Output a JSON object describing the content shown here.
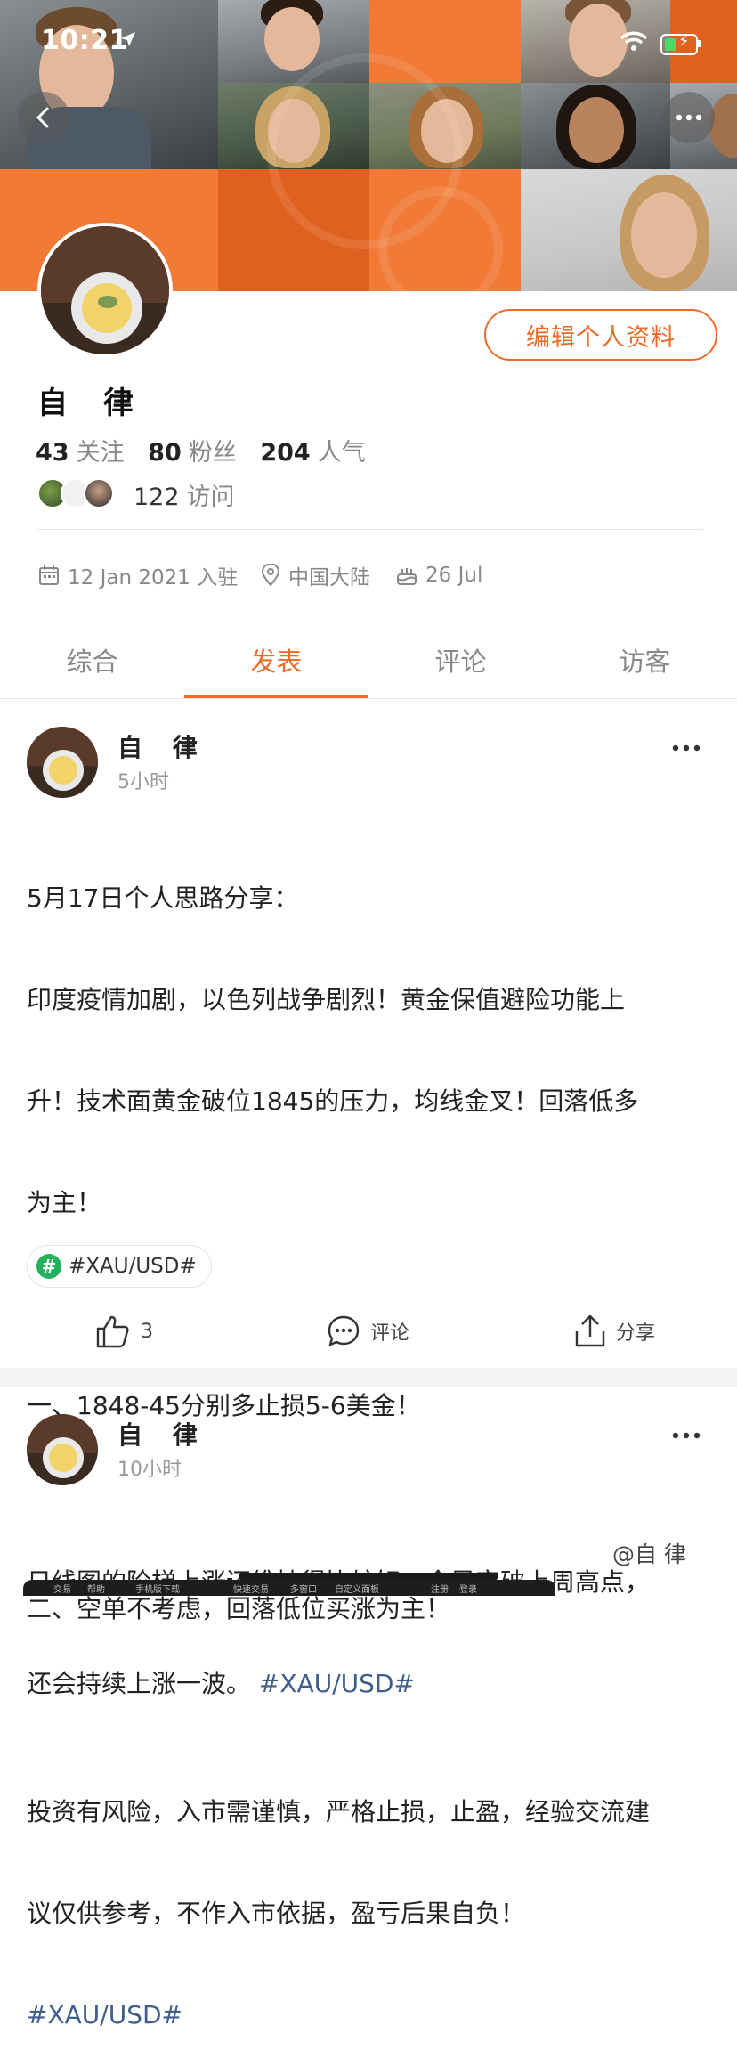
{
  "status_bar": {
    "time": "10:21"
  },
  "profile": {
    "edit_button": "编辑个人资料",
    "name": "自 律",
    "following_count": "43",
    "following_label": "关注",
    "followers_count": "80",
    "followers_label": "粉丝",
    "popularity_count": "204",
    "popularity_label": "人气",
    "visits_count": "122",
    "visits_label": "访问",
    "joined": "12 Jan 2021 入驻",
    "location": "中国大陆",
    "birthday": "26 Jul"
  },
  "tabs": [
    {
      "label": "综合",
      "active": false
    },
    {
      "label": "发表",
      "active": true
    },
    {
      "label": "评论",
      "active": false
    },
    {
      "label": "访客",
      "active": false
    }
  ],
  "posts": [
    {
      "author": "自 律",
      "time": "5小时",
      "lines": [
        "5月17日个人思路分享：",
        "印度疫情加剧，以色列战争剧烈！黄金保值避险功能上",
        "升！技术面黄金破位1845的压力，均线金叉！回落低多",
        "为主！",
        "",
        "一、1848-45分别多止损5-6美金！",
        "",
        "二、空单不考虑，回落低位买涨为主！",
        "",
        "投资有风险，入市需谨慎，严格止损，止盈，经验交流建",
        "议仅供参考，不作入市依据，盈亏后果自负！"
      ],
      "hashtag": "#XAU/USD#",
      "tag_chip": "#XAU/USD#",
      "tag_chip_icon": "#",
      "likes": "3",
      "comment_label": "评论",
      "share_label": "分享"
    },
    {
      "author": "自 律",
      "time": "10小时",
      "lines": [
        "日线图的阶梯上涨还维持得比较好，今早突破上周高点，",
        "还会持续上涨一波。"
      ],
      "hashtag": "#XAU/USD#"
    }
  ],
  "bottom_strip_items": [
    "交易",
    "帮助",
    "手机版下载",
    "快速交易",
    "多窗口",
    "自定义面板",
    "注册",
    "登录"
  ],
  "watermark": "@自 律",
  "colors": {
    "accent": "#ee6a28",
    "hashtag": "#3f5e8c",
    "tag_green": "#25b05d"
  }
}
